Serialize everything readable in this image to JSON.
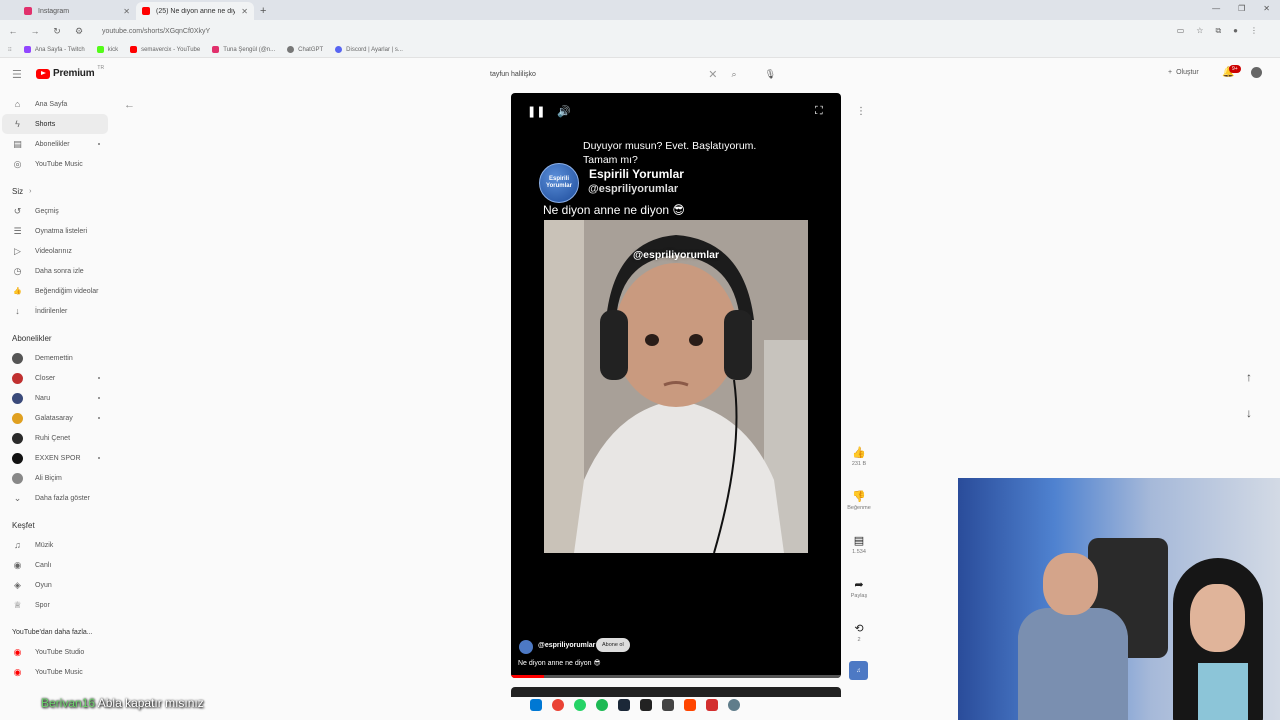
{
  "browser": {
    "tabs": [
      {
        "label": "Instagram",
        "color": "#e1306c",
        "active": false
      },
      {
        "label": "(25) Ne diyon anne ne diyo",
        "color": "#ff0000",
        "active": true
      }
    ],
    "url": "youtube.com/shorts/XGqnCf0XkyY",
    "bookmarks": [
      {
        "label": "Ana Sayfa - Twitch",
        "color": "#9146ff"
      },
      {
        "label": "kick",
        "color": "#53fc18"
      },
      {
        "label": "semavercix - YouTube",
        "color": "#ff0000"
      },
      {
        "label": "Tuna Şengül (@n...",
        "color": "#e1306c"
      },
      {
        "label": "ChatGPT",
        "color": "#777777"
      },
      {
        "label": "Discord | Ayarlar | s...",
        "color": "#5865f2"
      }
    ]
  },
  "header": {
    "logo_text": "Premium",
    "logo_sup": "TR",
    "search_query": "tayfun halilişko",
    "create_label": "Oluştur",
    "notif_count": "9+"
  },
  "sidebar": {
    "main": [
      {
        "label": "Ana Sayfa",
        "icon": "⌂"
      },
      {
        "label": "Shorts",
        "icon": "ϟ",
        "active": true
      },
      {
        "label": "Abonelikler",
        "icon": "▤",
        "dot": true
      },
      {
        "label": "YouTube Music",
        "icon": "◎"
      }
    ],
    "you_heading": "Siz",
    "you": [
      {
        "label": "Geçmiş",
        "icon": "↺"
      },
      {
        "label": "Oynatma listeleri",
        "icon": "☰"
      },
      {
        "label": "Videolarınız",
        "icon": "▷"
      },
      {
        "label": "Daha sonra izle",
        "icon": "◷"
      },
      {
        "label": "Beğendiğim videolar",
        "icon": "👍"
      },
      {
        "label": "İndirilenler",
        "icon": "↓"
      }
    ],
    "subs_heading": "Abonelikler",
    "subs": [
      {
        "label": "Dememettin",
        "color": "#555555",
        "dot": false
      },
      {
        "label": "Closer",
        "color": "#c03030",
        "dot": true
      },
      {
        "label": "Naru",
        "color": "#3a4a7a",
        "dot": true
      },
      {
        "label": "Galatasaray",
        "color": "#e0a020",
        "dot": true
      },
      {
        "label": "Ruhi Çenet",
        "color": "#2a2a2a",
        "dot": false
      },
      {
        "label": "EXXEN SPOR",
        "color": "#111111",
        "dot": true
      },
      {
        "label": "Ali Biçim",
        "color": "#888888",
        "dot": false
      }
    ],
    "show_more": "Daha fazla göster",
    "explore_heading": "Keşfet",
    "explore": [
      {
        "label": "Müzik",
        "icon": "♫"
      },
      {
        "label": "Canlı",
        "icon": "◉"
      },
      {
        "label": "Oyun",
        "icon": "◈"
      },
      {
        "label": "Spor",
        "icon": "♕"
      }
    ],
    "more_heading": "YouTube'dan daha fazla...",
    "more": [
      {
        "label": "YouTube Studio",
        "color": "#ff0000"
      },
      {
        "label": "YouTube Music",
        "color": "#ff0000"
      }
    ]
  },
  "short": {
    "caption": "Duyuyor musun? Evet. Başlatıyorum. Tamam mı?",
    "channel_logo_text": "Espirili Yorumlar",
    "channel_name": "Espirili Yorumlar",
    "channel_handle": "@espriliyorumlar",
    "clip_title": "Ne diyon anne ne diyon 😎",
    "watermark": "@espriliyorumlar",
    "overlay_handle": "@espriliyorumlar",
    "subscribe_label": "Abone ol",
    "overlay_title": "Ne diyon anne ne diyon 😎",
    "progress": 0.1
  },
  "actions": {
    "likes": "231 B",
    "dislike_label": "Beğenme",
    "comments": "1.534",
    "share_label": "Paylaş",
    "remix_count": "2"
  },
  "chat": {
    "user": "Berivan16",
    "message": "Abla kapatır mısınız"
  },
  "taskbar": [
    "#0078d4",
    "#ea4335",
    "#25d366",
    "#1db954",
    "#1b2838",
    "#222222",
    "#444444",
    "#ff4500",
    "#d32f2f",
    "#607d8b"
  ]
}
